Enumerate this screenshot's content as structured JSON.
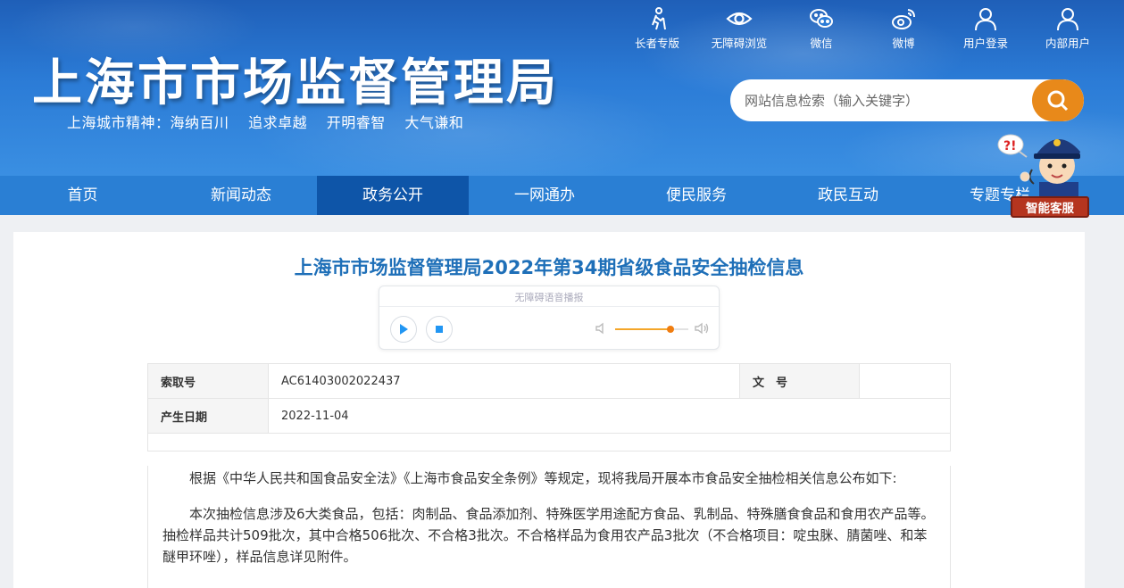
{
  "header": {
    "site_title": "上海市市场监督管理局",
    "slogan": [
      "上海城市精神：海纳百川",
      "追求卓越",
      "开明睿智",
      "大气谦和"
    ],
    "top_links": [
      {
        "label": "长者专版",
        "icon": "elder-icon"
      },
      {
        "label": "无障碍浏览",
        "icon": "eye-icon"
      },
      {
        "label": "微信",
        "icon": "wechat-icon"
      },
      {
        "label": "微博",
        "icon": "weibo-icon"
      },
      {
        "label": "用户登录",
        "icon": "user-icon"
      },
      {
        "label": "内部用户",
        "icon": "user-icon"
      }
    ],
    "search": {
      "placeholder": "网站信息检索（输入关键字）"
    },
    "colors": {
      "header_blue": "#2b7bd6",
      "search_button": "#e8891a",
      "nav_blue": "#2a7fd4",
      "nav_active": "#0e55a8"
    }
  },
  "nav": {
    "items": [
      "首页",
      "新闻动态",
      "政务公开",
      "一网通办",
      "便民服务",
      "政民互动",
      "专题专栏"
    ],
    "active_index": 2
  },
  "service": {
    "label": "智能客服"
  },
  "article": {
    "title": "上海市市场监督管理局2022年第34期省级食品安全抽检信息",
    "audio": {
      "label": "无障碍语音播报",
      "volume": 0.75
    },
    "meta": {
      "index_label": "索取号",
      "index_value": "AC61403002022437",
      "doc_label": "文　号",
      "doc_value": "",
      "date_label": "产生日期",
      "date_value": "2022-11-04"
    },
    "paragraphs": [
      "根据《中华人民共和国食品安全法》《上海市食品安全条例》等规定，现将我局开展本市食品安全抽检相关信息公布如下:",
      "本次抽检信息涉及6大类食品，包括：肉制品、食品添加剂、特殊医学用途配方食品、乳制品、特殊膳食食品和食用农产品等。抽检样品共计509批次，其中合格506批次、不合格3批次。不合格样品为食用农产品3批次（不合格项目：啶虫脒、腈菌唑、和苯醚甲环唑），样品信息详见附件。"
    ]
  }
}
